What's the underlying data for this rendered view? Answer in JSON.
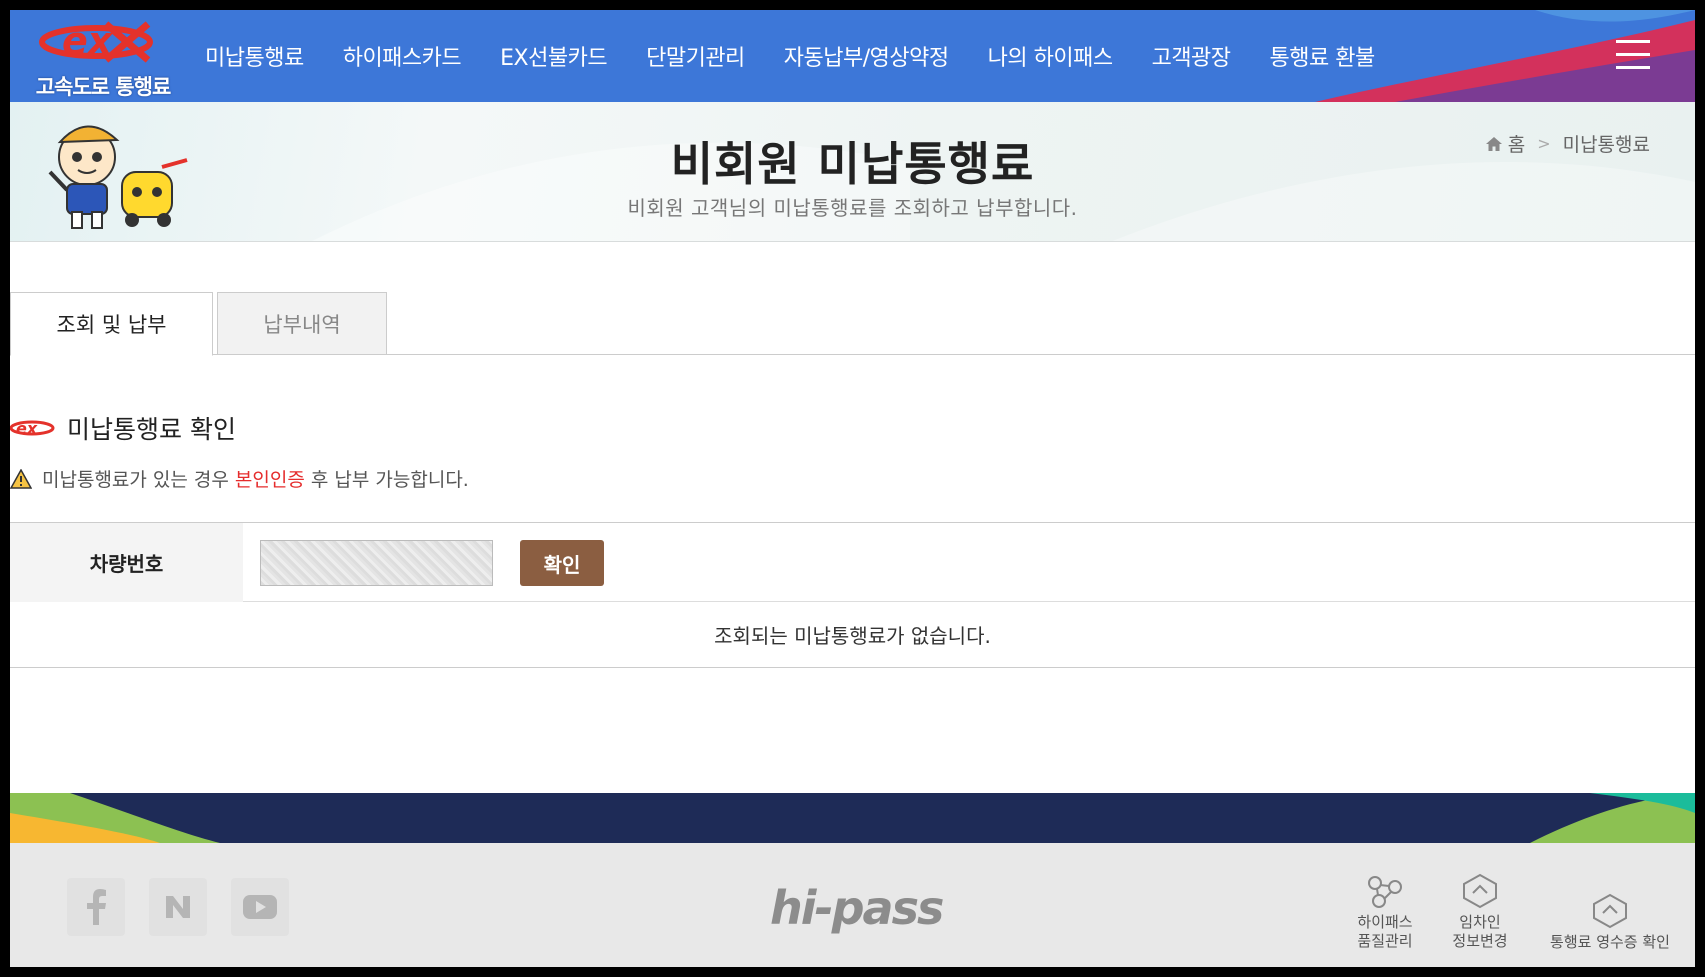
{
  "header": {
    "logo_text": "고속도로 통행료",
    "nav": [
      "미납통행료",
      "하이패스카드",
      "EX선불카드",
      "단말기관리",
      "자동납부/영상약정",
      "나의 하이패스",
      "고객광장",
      "통행료 환불"
    ]
  },
  "title_band": {
    "title": "비회원 미납통행료",
    "subtitle": "비회원 고객님의 미납통행료를 조회하고 납부합니다.",
    "breadcrumb_home": "홈",
    "breadcrumb_current": "미납통행료"
  },
  "tabs": [
    {
      "label": "조회 및 납부",
      "active": true
    },
    {
      "label": "납부내역",
      "active": false
    }
  ],
  "section": {
    "title": "미납통행료 확인",
    "warn_pre": "미납통행료가 있는 경우 ",
    "warn_red": "본인인증",
    "warn_post": " 후 납부 가능합니다."
  },
  "form": {
    "label": "차량번호",
    "button": "확인",
    "result": "조회되는 미납통행료가 없습니다."
  },
  "footer": {
    "brand": "hi-pass",
    "links": [
      {
        "line1": "하이패스",
        "line2": "품질관리"
      },
      {
        "line1": "임차인",
        "line2": "정보변경"
      },
      {
        "line1": "통행료 영수증 확인",
        "line2": ""
      }
    ]
  },
  "colors": {
    "header_blue": "#3d77d8",
    "button_brown": "#8b5e41",
    "footer_navy": "#1e2b57",
    "accent_red": "#e52c2c"
  }
}
